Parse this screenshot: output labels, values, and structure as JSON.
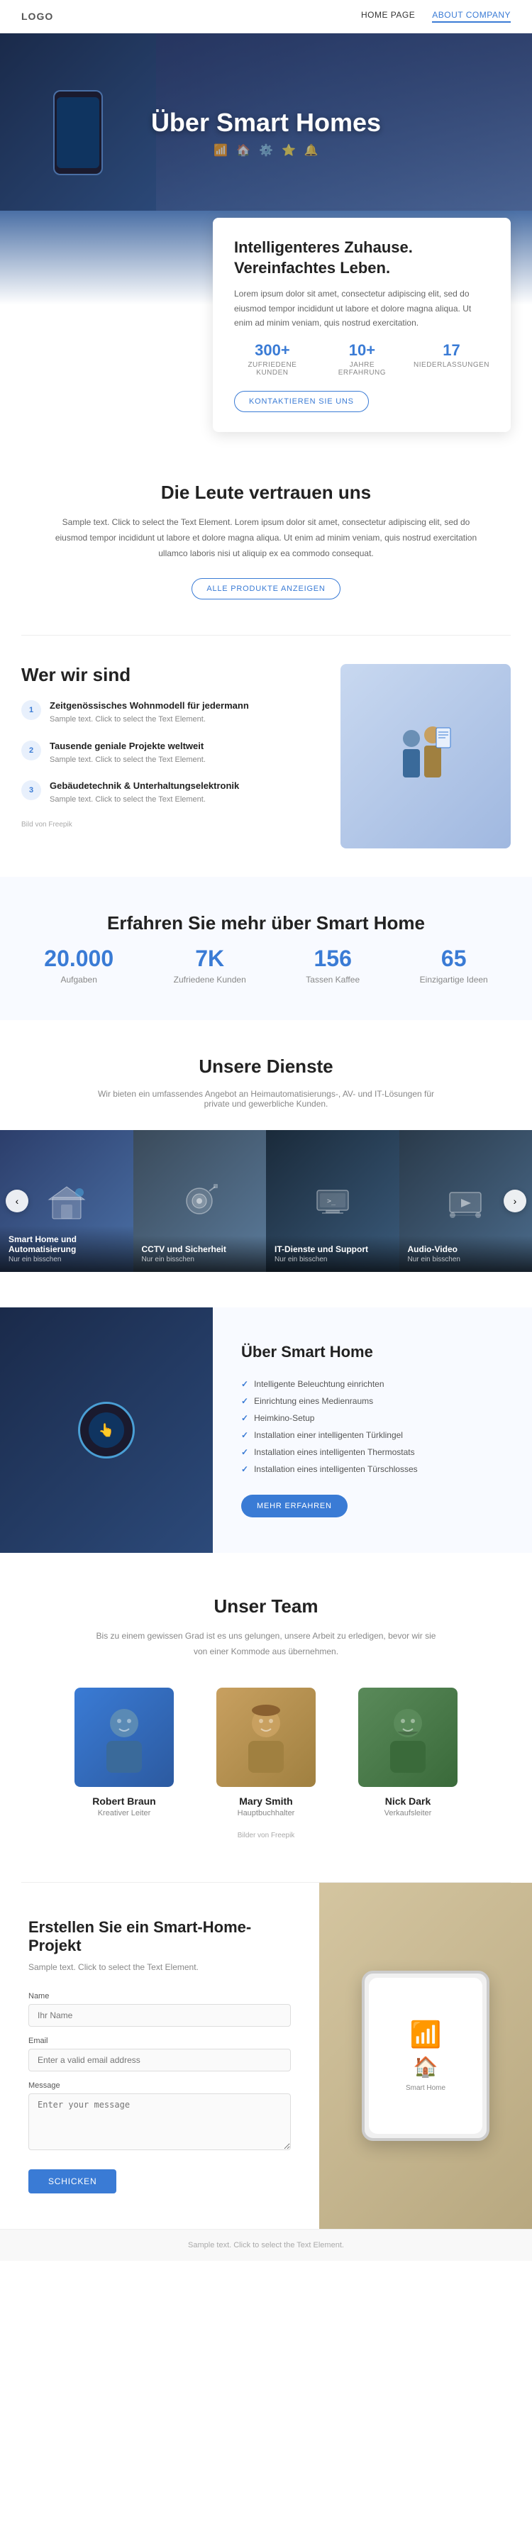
{
  "nav": {
    "logo": "logo",
    "links": [
      {
        "label": "HOME PAGE",
        "active": false
      },
      {
        "label": "ABOUT COMPANY",
        "active": true
      }
    ]
  },
  "hero": {
    "title": "Über Smart Homes",
    "icons": [
      "wifi",
      "home",
      "settings",
      "star",
      "bell"
    ]
  },
  "card": {
    "title": "Intelligenteres Zuhause. Vereinfachtes Leben.",
    "description": "Lorem ipsum dolor sit amet, consectetur adipiscing elit, sed do eiusmod tempor incididunt ut labore et dolore magna aliqua. Ut enim ad minim veniam, quis nostrud exercitation.",
    "stats": [
      {
        "number": "300+",
        "label": "ZUFRIEDENE KUNDEN"
      },
      {
        "number": "10+",
        "label": "JAHRE ERFAHRUNG"
      },
      {
        "number": "17",
        "label": "NIEDERLASSUNGEN"
      }
    ],
    "button": "KONTAKTIEREN SIE UNS"
  },
  "trust": {
    "title": "Die Leute vertrauen uns",
    "text": "Sample text. Click to select the Text Element. Lorem ipsum dolor sit amet, consectetur adipiscing elit, sed do eiusmod tempor incididunt ut labore et dolore magna aliqua. Ut enim ad minim veniam, quis nostrud exercitation ullamco laboris nisi ut aliquip ex ea commodo consequat.",
    "button": "ALLE PRODUKTE ANZEIGEN"
  },
  "who": {
    "title": "Wer wir sind",
    "items": [
      {
        "num": "1",
        "title": "Zeitgenössisches Wohnmodell für jedermann",
        "text": "Sample text. Click to select the Text Element."
      },
      {
        "num": "2",
        "title": "Tausende geniale Projekte weltweit",
        "text": "Sample text. Click to select the Text Element."
      },
      {
        "num": "3",
        "title": "Gebäudetechnik & Unterhaltungselektronik",
        "text": "Sample text. Click to select the Text Element."
      }
    ],
    "image_credit": "Bild von Freepik"
  },
  "stats_bar": {
    "title": "Erfahren Sie mehr über Smart Home",
    "items": [
      {
        "number": "20.000",
        "label": "Aufgaben"
      },
      {
        "number": "7K",
        "label": "Zufriedene Kunden"
      },
      {
        "number": "156",
        "label": "Tassen Kaffee"
      },
      {
        "number": "65",
        "label": "Einzigartige Ideen"
      }
    ]
  },
  "services": {
    "title": "Unsere Dienste",
    "description": "Wir bieten ein umfassendes Angebot an Heimautomatisierungs-, AV- und IT-Lösungen für private und gewerbliche Kunden.",
    "cards": [
      {
        "title": "Smart Home und Automatisierung",
        "sub": "Nur ein bisschen"
      },
      {
        "title": "CCTV und Sicherheit",
        "sub": "Nur ein bisschen"
      },
      {
        "title": "IT-Dienste und Support",
        "sub": "Nur ein bisschen"
      },
      {
        "title": "Audio-Video",
        "sub": "Nur ein bisschen"
      }
    ]
  },
  "uber": {
    "title": "Über Smart Home",
    "checklist": [
      "Intelligente Beleuchtung einrichten",
      "Einrichtung eines Medienraums",
      "Heimkino-Setup",
      "Installation einer intelligenten Türklingel",
      "Installation eines intelligenten Thermostats",
      "Installation eines intelligenten Türschlosses"
    ],
    "button": "MEHR ERFAHREN"
  },
  "team": {
    "title": "Unser Team",
    "description": "Bis zu einem gewissen Grad ist es uns gelungen, unsere Arbeit zu erledigen, bevor wir sie von einer Kommode aus übernehmen.",
    "members": [
      {
        "name": "Robert Braun",
        "role": "Kreativer Leiter",
        "avatar": "👨"
      },
      {
        "name": "Mary Smith",
        "role": "Hauptbuchhalter",
        "avatar": "👩"
      },
      {
        "name": "Nick Dark",
        "role": "Verkaufsleiter",
        "avatar": "🧔"
      }
    ],
    "image_credit": "Bilder von Freepik"
  },
  "contact": {
    "title": "Erstellen Sie ein Smart-Home-Projekt",
    "description": "Sample text. Click to select the Text Element.",
    "fields": [
      {
        "label": "Name",
        "placeholder": "Ihr Name",
        "type": "text"
      },
      {
        "label": "Email",
        "placeholder": "Enter a valid email address",
        "type": "email"
      },
      {
        "label": "Message",
        "placeholder": "Enter your message",
        "type": "textarea"
      }
    ],
    "button": "SCHICKEN",
    "footer_text": "Sample text. Click to select the Text Element."
  }
}
